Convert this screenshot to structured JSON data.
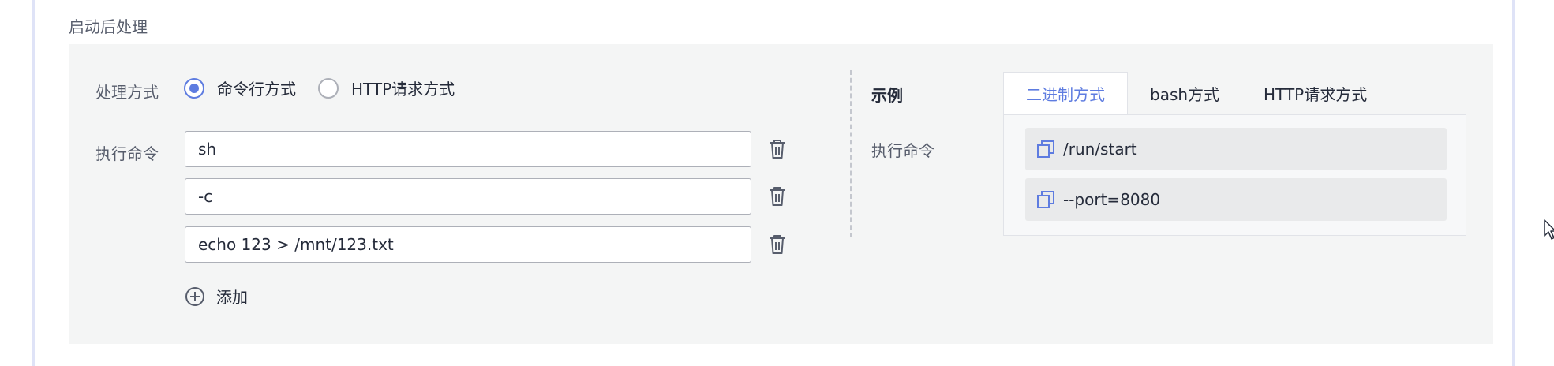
{
  "section": {
    "title": "启动后处理"
  },
  "mode": {
    "label": "处理方式",
    "options": [
      {
        "label": "命令行方式",
        "checked": true
      },
      {
        "label": "HTTP请求方式",
        "checked": false
      }
    ]
  },
  "commands": {
    "label": "执行命令",
    "items": [
      "sh",
      "-c",
      "echo 123 > /mnt/123.txt"
    ],
    "delete_icon": "trash-icon",
    "add_label": "添加",
    "add_icon": "plus-circle-icon"
  },
  "example": {
    "title": "示例",
    "tabs": [
      {
        "label": "二进制方式",
        "active": true
      },
      {
        "label": "bash方式",
        "active": false
      },
      {
        "label": "HTTP请求方式",
        "active": false
      }
    ],
    "cmd_label": "执行命令",
    "code": [
      "/run/start",
      "--port=8080"
    ],
    "copy_icon": "copy-icon"
  },
  "colors": {
    "accent": "#5e7ce0",
    "panel_bg": "#f4f5f5",
    "text": "#252b3a",
    "muted": "#575d6c"
  }
}
